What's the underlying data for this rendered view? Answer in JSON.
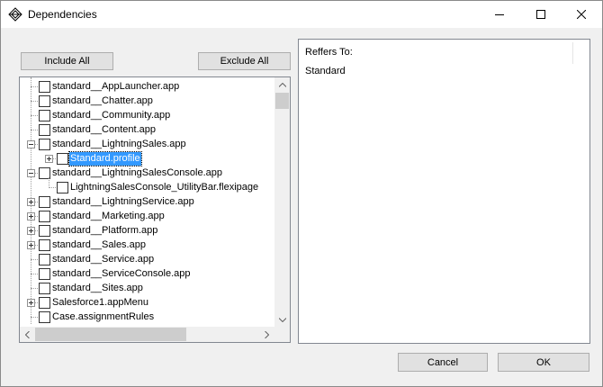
{
  "window": {
    "title": "Dependencies",
    "icon": "dependencies-app-icon",
    "controls": [
      "minimize-icon",
      "maximize-icon",
      "close-icon"
    ]
  },
  "buttons": {
    "include_all": "Include All",
    "exclude_all": "Exclude All",
    "cancel": "Cancel",
    "ok": "OK"
  },
  "tree": {
    "nodes": [
      {
        "label": "standard__AppLauncher.app",
        "level": 0,
        "expander": "none",
        "checked": false,
        "selected": false
      },
      {
        "label": "standard__Chatter.app",
        "level": 0,
        "expander": "none",
        "checked": false,
        "selected": false
      },
      {
        "label": "standard__Community.app",
        "level": 0,
        "expander": "none",
        "checked": false,
        "selected": false
      },
      {
        "label": "standard__Content.app",
        "level": 0,
        "expander": "none",
        "checked": false,
        "selected": false
      },
      {
        "label": "standard__LightningSales.app",
        "level": 0,
        "expander": "minus",
        "checked": false,
        "selected": false
      },
      {
        "label": "Standard.profile",
        "level": 1,
        "expander": "plus",
        "checked": false,
        "selected": true
      },
      {
        "label": "standard__LightningSalesConsole.app",
        "level": 0,
        "expander": "minus",
        "checked": false,
        "selected": false
      },
      {
        "label": "LightningSalesConsole_UtilityBar.flexipage",
        "level": 1,
        "expander": "none",
        "checked": false,
        "selected": false
      },
      {
        "label": "standard__LightningService.app",
        "level": 0,
        "expander": "plus",
        "checked": false,
        "selected": false
      },
      {
        "label": "standard__Marketing.app",
        "level": 0,
        "expander": "plus",
        "checked": false,
        "selected": false
      },
      {
        "label": "standard__Platform.app",
        "level": 0,
        "expander": "plus",
        "checked": false,
        "selected": false
      },
      {
        "label": "standard__Sales.app",
        "level": 0,
        "expander": "plus",
        "checked": false,
        "selected": false
      },
      {
        "label": "standard__Service.app",
        "level": 0,
        "expander": "none",
        "checked": false,
        "selected": false
      },
      {
        "label": "standard__ServiceConsole.app",
        "level": 0,
        "expander": "none",
        "checked": false,
        "selected": false
      },
      {
        "label": "standard__Sites.app",
        "level": 0,
        "expander": "none",
        "checked": false,
        "selected": false
      },
      {
        "label": "Salesforce1.appMenu",
        "level": 0,
        "expander": "plus",
        "checked": false,
        "selected": false
      },
      {
        "label": "Case.assignmentRules",
        "level": 0,
        "expander": "none",
        "checked": false,
        "selected": false
      }
    ]
  },
  "refers": {
    "header": "Reffers To:",
    "items": [
      "Standard"
    ]
  },
  "colors": {
    "selection": "#3399ff",
    "window_bg": "#f0f0f0"
  }
}
